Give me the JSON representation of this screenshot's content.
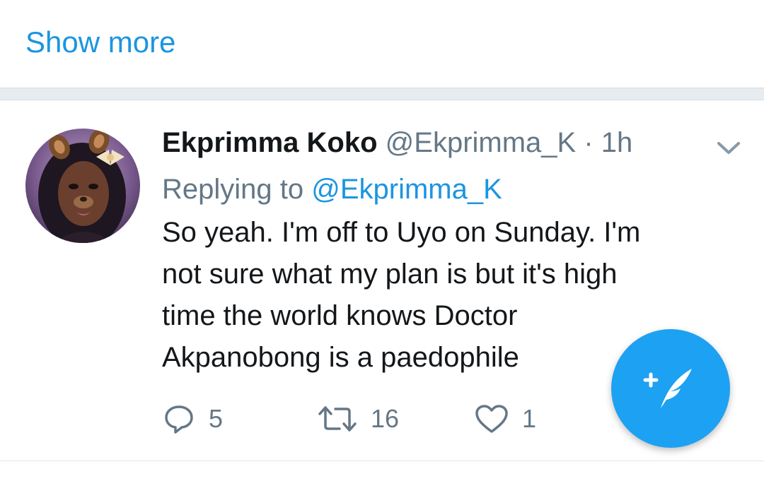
{
  "show_more": {
    "label": "Show more"
  },
  "tweet": {
    "display_name": "Ekprimma Koko",
    "handle": "@Ekprimma_K",
    "separator": "·",
    "time": "1h",
    "replying_prefix": "Replying to ",
    "replying_handle": "@Ekprimma_K",
    "text_lines": [
      "So yeah. I'm off to Uyo on Sunday. I'm",
      "not sure what my plan is but it's high",
      "time the world knows Doctor",
      "Akpanobong is a paedophile"
    ],
    "actions": {
      "reply_count": "5",
      "retweet_count": "16",
      "like_count": "1"
    }
  },
  "icons": {
    "menu_caret": "chevron-down-icon",
    "reply": "speech-bubble-icon",
    "retweet": "retweet-arrows-icon",
    "like": "heart-icon",
    "compose": "compose-feather-icon"
  },
  "colors": {
    "accent": "#1da1f2",
    "link": "#1b95e0",
    "secondary_text": "#657786",
    "primary_text": "#14171a",
    "separator": "#e6ecf0"
  }
}
